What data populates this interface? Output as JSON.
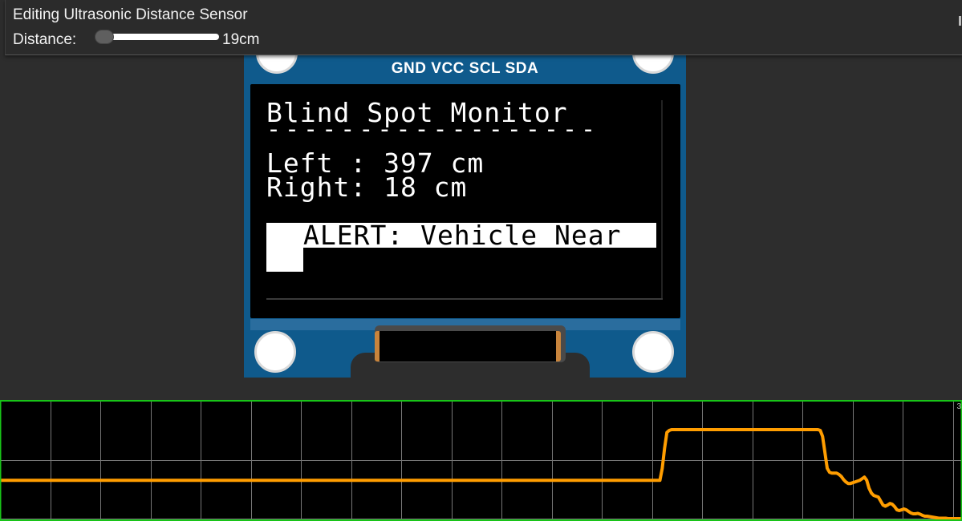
{
  "panel": {
    "title": "Editing Ultrasonic Distance Sensor",
    "distance_label": "Distance:",
    "distance_value": "19cm",
    "slider_fraction": 0.02
  },
  "oled": {
    "pins": "GND VCC SCL SDA",
    "title": "Blind Spot Monitor",
    "divider": "------------------",
    "left_line": "Left : 397 cm",
    "right_line": "Right: 18 cm",
    "alert": "ALERT: Vehicle Near"
  },
  "plotter": {
    "ymax_label": "3",
    "colors": {
      "border": "#18c418",
      "grid": "#777777",
      "trace": "#ff9d00"
    },
    "series": [
      270,
      270,
      270,
      270,
      270,
      270,
      270,
      270,
      270,
      270,
      270,
      270,
      270,
      270,
      270,
      270,
      270,
      270,
      270,
      270,
      270,
      270,
      270,
      270,
      270,
      270,
      270,
      270,
      270,
      270,
      270,
      270,
      270,
      270,
      270,
      270,
      270,
      270,
      270,
      270,
      270,
      270,
      270,
      270,
      270,
      270,
      270,
      270,
      270,
      270,
      270,
      270,
      270,
      270,
      270,
      270,
      270,
      270,
      270,
      270,
      270,
      270,
      270,
      270,
      270,
      270,
      270,
      270,
      270,
      270,
      270,
      270,
      270,
      270,
      270,
      270,
      270,
      270,
      270,
      270,
      270,
      270,
      270,
      270,
      270,
      270,
      270,
      270,
      270,
      270,
      270,
      270,
      270,
      270,
      270,
      270,
      270,
      270,
      270,
      270,
      270,
      270,
      270,
      270,
      270,
      270,
      270,
      270,
      270,
      270,
      270,
      270,
      270,
      270,
      270,
      270,
      270,
      270,
      270,
      270,
      270,
      270,
      270,
      270,
      270,
      270,
      270,
      270,
      270,
      270,
      270,
      270,
      270,
      270,
      270,
      270,
      270,
      270,
      270,
      270,
      270,
      270,
      270,
      270,
      270,
      270,
      270,
      270,
      270,
      270,
      270,
      270,
      270,
      270,
      270,
      270,
      270,
      270,
      270,
      270,
      270,
      270,
      270,
      270,
      270,
      270,
      270,
      270,
      270,
      270,
      270,
      270,
      270,
      270,
      270,
      270,
      270,
      270,
      270,
      270,
      270,
      270,
      270,
      270,
      270,
      270,
      270,
      270,
      270,
      270,
      270,
      270,
      270,
      270,
      270,
      270,
      270,
      270,
      270,
      270,
      270,
      270,
      270,
      270,
      270,
      270,
      270,
      270,
      270,
      270,
      270,
      270,
      270,
      270,
      270,
      270,
      270,
      270,
      270,
      270,
      270,
      270,
      270,
      270,
      270,
      270,
      270,
      270,
      270,
      270,
      270,
      270,
      270,
      270,
      270,
      270,
      270,
      270,
      270,
      270,
      270,
      270,
      270,
      270,
      270,
      270,
      270,
      270,
      270,
      270,
      270,
      270,
      270,
      270,
      270,
      270,
      270,
      270,
      270,
      270,
      270,
      270,
      270,
      270,
      270,
      270,
      270,
      270,
      270,
      270,
      270,
      270,
      270,
      270,
      270,
      270,
      270,
      270,
      270,
      270,
      270,
      270,
      270,
      270,
      270,
      300,
      350,
      390,
      395,
      397,
      397,
      397,
      397,
      397,
      397,
      397,
      397,
      397,
      397,
      397,
      397,
      397,
      397,
      397,
      397,
      397,
      397,
      397,
      397,
      397,
      397,
      397,
      397,
      397,
      397,
      397,
      397,
      397,
      397,
      397,
      397,
      397,
      397,
      397,
      397,
      397,
      397,
      397,
      397,
      397,
      397,
      397,
      397,
      397,
      397,
      397,
      397,
      397,
      397,
      397,
      397,
      397,
      397,
      397,
      397,
      397,
      397,
      397,
      397,
      397,
      397,
      397,
      397,
      395,
      380,
      340,
      300,
      290,
      288,
      288,
      288,
      285,
      280,
      272,
      266,
      262,
      262,
      264,
      266,
      268,
      270,
      274,
      278,
      270,
      250,
      238,
      232,
      230,
      228,
      218,
      208,
      205,
      208,
      212,
      210,
      204,
      196,
      194,
      196,
      198,
      196,
      192,
      188,
      186,
      186,
      187,
      185,
      182,
      180,
      180,
      179,
      178,
      177,
      176,
      175,
      175,
      175,
      175,
      174,
      174,
      174,
      174,
      174,
      174,
      174
    ]
  }
}
